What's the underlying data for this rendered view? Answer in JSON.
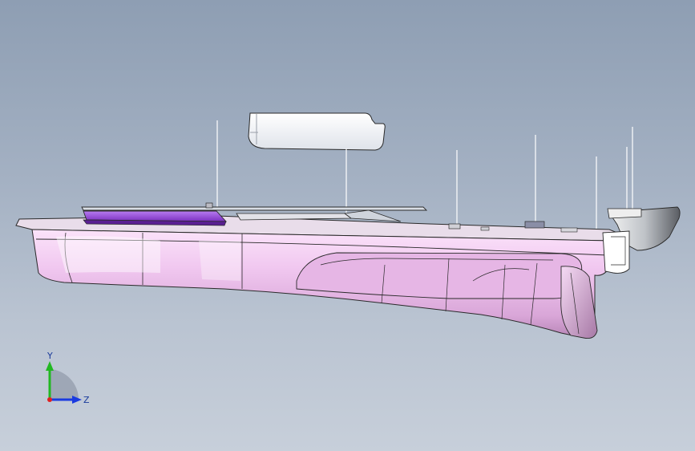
{
  "viewport": {
    "triad": {
      "y_label": "Y",
      "z_label": "Z",
      "y_color": "#22b822",
      "z_color": "#1a3ae0",
      "x_color": "#e02020"
    },
    "model": {
      "hull_color": "#f0c6ef",
      "accent_color": "#9a3fd6",
      "edge_color": "#2a2a2a"
    }
  }
}
